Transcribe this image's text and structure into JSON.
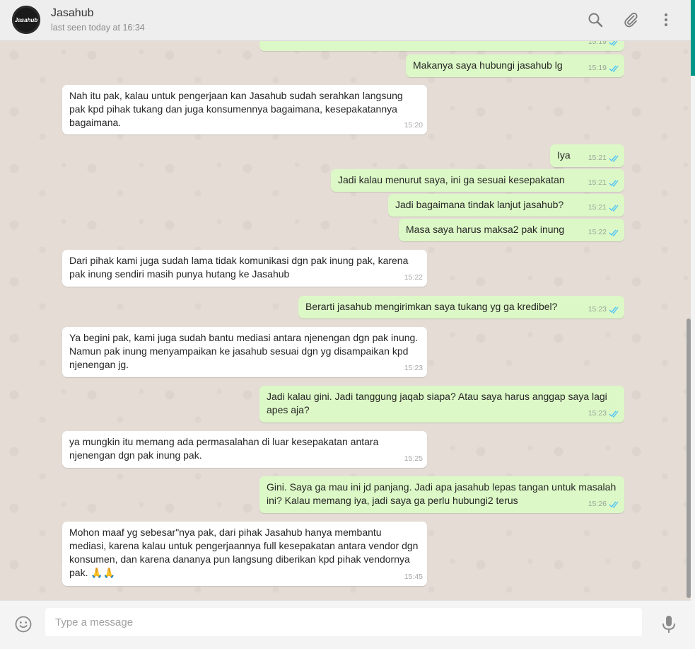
{
  "header": {
    "contact_name": "Jasahub",
    "status": "last seen today at 16:34",
    "avatar_text": "Jasahub",
    "icons": [
      "search-icon",
      "attach-icon",
      "menu-icon"
    ]
  },
  "messages": [
    {
      "dir": "out",
      "text": "",
      "time": "15:19",
      "ticks": true
    },
    {
      "dir": "out",
      "text": "Makanya saya hubungi jasahub lg",
      "time": "15:19",
      "ticks": true
    },
    {
      "dir": "in",
      "text": "Nah itu pak, kalau untuk pengerjaan kan Jasahub sudah serahkan langsung pak kpd pihak tukang dan juga konsumennya bagaimana, kesepakatannya bagaimana.",
      "time": "15:20"
    },
    {
      "dir": "out",
      "text": "Iya",
      "time": "15:21",
      "ticks": true
    },
    {
      "dir": "out",
      "text": "Jadi kalau menurut saya, ini ga sesuai kesepakatan",
      "time": "15:21",
      "ticks": true
    },
    {
      "dir": "out",
      "text": "Jadi bagaimana tindak lanjut jasahub?",
      "time": "15:21",
      "ticks": true
    },
    {
      "dir": "out",
      "text": "Masa saya harus maksa2 pak inung",
      "time": "15:22",
      "ticks": true
    },
    {
      "dir": "in",
      "text": "Dari pihak kami juga sudah lama tidak komunikasi dgn pak inung pak, karena pak inung sendiri masih punya hutang ke Jasahub",
      "time": "15:22"
    },
    {
      "dir": "out",
      "text": "Berarti jasahub mengirimkan saya tukang yg ga kredibel?",
      "time": "15:23",
      "ticks": true
    },
    {
      "dir": "in",
      "text": "Ya begini pak, kami juga sudah bantu mediasi antara njenengan dgn pak inung. Namun pak inung menyampaikan ke jasahub sesuai dgn yg disampaikan kpd njenengan jg.",
      "time": "15:23"
    },
    {
      "dir": "out",
      "text": "Jadi kalau gini. Jadi tanggung jaqab siapa? Atau saya harus anggap saya lagi apes aja?",
      "time": "15:23",
      "ticks": true
    },
    {
      "dir": "in",
      "text": "ya mungkin itu memang ada permasalahan di luar kesepakatan antara njenengan dgn pak inung pak.",
      "time": "15:25"
    },
    {
      "dir": "out",
      "text": "Gini. Saya ga mau ini jd panjang. Jadi apa jasahub lepas tangan untuk masalah ini? Kalau memang iya, jadi saya ga perlu hubungi2 terus",
      "time": "15:26",
      "ticks": true
    },
    {
      "dir": "in",
      "text": "Mohon maaf yg sebesar\"nya pak, dari pihak Jasahub hanya membantu mediasi, karena kalau untuk pengerjaannya full kesepakatan antara vendor dgn konsumen, dan karena dananya pun langsung diberikan kpd pihak vendornya pak. 🙏🙏",
      "time": "15:45"
    }
  ],
  "composer": {
    "placeholder": "Type a message",
    "value": ""
  },
  "colors": {
    "incoming": "#ffffff",
    "outgoing": "#dcf8c6",
    "chat_bg": "#e5ddd5",
    "tick": "#4fc3f7",
    "accent": "#009688"
  }
}
